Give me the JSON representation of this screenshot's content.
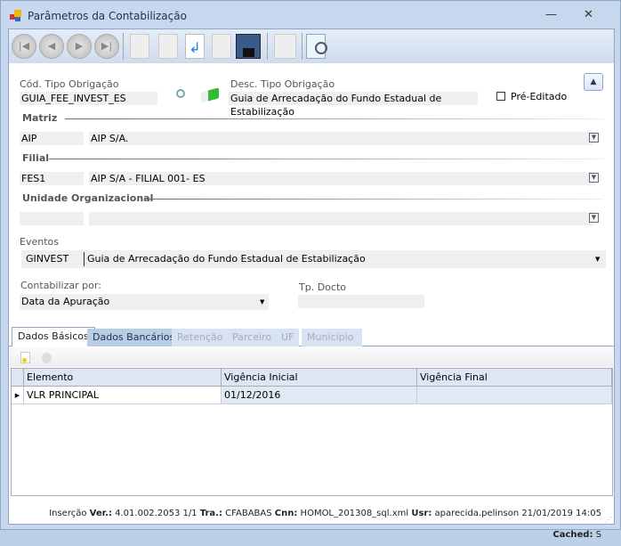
{
  "window": {
    "title": "Parâmetros da Contabilização",
    "minimize": "—",
    "close": "✕"
  },
  "form": {
    "cod_label": "Cód. Tipo Obrigação",
    "cod_value": "GUIA_FEE_INVEST_ES",
    "desc_label": "Desc. Tipo Obrigação",
    "desc_value": "Guia de Arrecadação do Fundo Estadual de Estabilização",
    "pre_editado": "Pré-Editado",
    "matriz_label": "Matriz",
    "matriz_code": "AIP",
    "matriz_name": "AIP S/A.",
    "filial_label": "Filial",
    "filial_code": "FES1",
    "filial_name": "AIP S/A - FILIAL 001- ES",
    "unidade_label": "Unidade Organizacional",
    "unidade_code": "",
    "unidade_name": "",
    "eventos_label": "Eventos",
    "eventos_code": "GINVEST",
    "eventos_name": "Guia de Arrecadação do Fundo Estadual de Estabilização",
    "contabilizar_label": "Contabilizar por:",
    "contabilizar_value": "Data da Apuração",
    "tpdocto_label": "Tp. Docto",
    "tpdocto_value": ""
  },
  "tabs": [
    "Dados Básicos",
    "Dados Bancários",
    "Retenção",
    "Parceiro",
    "UF",
    "Município"
  ],
  "grid": {
    "columns": [
      "Elemento",
      "Vigência Inicial",
      "Vigência Final"
    ],
    "rows": [
      [
        "VLR PRINCIPAL",
        "01/12/2016",
        ""
      ]
    ]
  },
  "status": {
    "mode": "Inserção",
    "ver_label": "Ver.:",
    "ver": "4.01.002.2053",
    "page": "1/1",
    "tra_label": "Tra.:",
    "tra": "CFABABAS",
    "cnn_label": "Cnn:",
    "cnn": "HOMOL_201308_sql.xml",
    "usr_label": "Usr:",
    "usr": "aparecida.pelinson",
    "datetime": "21/01/2019 14:05",
    "cached_label": "Cached:",
    "cached": "S"
  }
}
